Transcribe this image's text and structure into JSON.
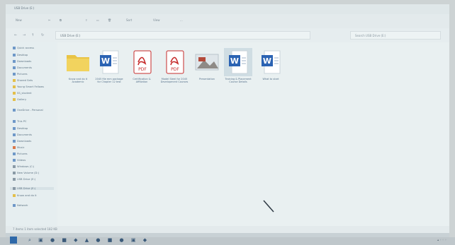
{
  "window": {
    "title": "USB Drive (E:)"
  },
  "toolbar": {
    "new_label": "New",
    "sort_label": "Sort",
    "view_label": "View",
    "more_label": "..."
  },
  "address": {
    "path": "USB Drive (E:)",
    "search_placeholder": "Search USB Drive (E:)"
  },
  "sidebar": {
    "items": [
      {
        "label": "Quick access",
        "icon": "star-icon"
      },
      {
        "label": "Desktop",
        "icon": "desktop-icon"
      },
      {
        "label": "Downloads",
        "icon": "download-icon"
      },
      {
        "label": "Documents",
        "icon": "document-icon"
      },
      {
        "label": "Pictures",
        "icon": "picture-icon"
      },
      {
        "label": "Shared Sets",
        "icon": "folder-icon"
      },
      {
        "label": "Young Smart Fellows",
        "icon": "folder-icon"
      },
      {
        "label": "SS_student",
        "icon": "folder-icon"
      },
      {
        "label": "Gallery",
        "icon": "folder-icon"
      },
      {
        "label": "OneDrive - Personal",
        "icon": "cloud-icon"
      },
      {
        "label": "This PC",
        "icon": "pc-icon"
      },
      {
        "label": "Desktop",
        "icon": "desktop-icon"
      },
      {
        "label": "Documents",
        "icon": "document-icon"
      },
      {
        "label": "Downloads",
        "icon": "download-icon"
      },
      {
        "label": "Music",
        "icon": "music-icon"
      },
      {
        "label": "Pictures",
        "icon": "picture-icon"
      },
      {
        "label": "Videos",
        "icon": "video-icon"
      },
      {
        "label": "Windows (C:)",
        "icon": "drive-icon"
      },
      {
        "label": "New Volume (D:)",
        "icon": "drive-icon"
      },
      {
        "label": "USB Drive (E:)",
        "icon": "usb-icon"
      },
      {
        "label": "USB Drive (E:)",
        "icon": "usb-icon",
        "selected": true
      },
      {
        "label": "Know and do it",
        "icon": "folder-icon"
      },
      {
        "label": "Network",
        "icon": "network-icon"
      }
    ]
  },
  "files": [
    {
      "name": "Know and do it Academic",
      "type": "folder",
      "icon": "folder-icon"
    },
    {
      "name": "2045 file mm package for Chapter 12 test",
      "type": "word",
      "icon": "word-icon"
    },
    {
      "name": "Certification & Affiliation",
      "type": "pdf",
      "icon": "pdf-icon"
    },
    {
      "name": "Model Steel for 2045 Development Courses",
      "type": "pdf",
      "icon": "pdf-icon"
    },
    {
      "name": "Presentation",
      "type": "image",
      "icon": "image-icon"
    },
    {
      "name": "Training & Placement Course Details",
      "type": "word",
      "icon": "word-icon",
      "selected": true
    },
    {
      "name": "What to start",
      "type": "word",
      "icon": "word-icon"
    }
  ],
  "status": {
    "text": "7 items   1 item selected  182 KB"
  },
  "colors": {
    "word": "#2b63b3",
    "pdf": "#c62b2b",
    "folder": "#e9c445",
    "start": "#2e68a8"
  }
}
